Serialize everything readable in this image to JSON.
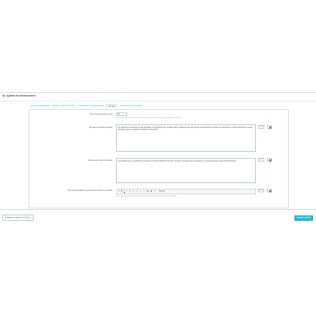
{
  "panel": {
    "title": "Ajustes de devoluciones",
    "icon": "wrench-icon"
  },
  "tabs": [
    {
      "label": "AJUSTES GENERALES",
      "active": false
    },
    {
      "label": "ESTADO Y NOTIFICACIÓN",
      "active": false
    },
    {
      "label": "PRINCIPIOS Y CONDICIONES",
      "active": false
    },
    {
      "label": "EXTRAS",
      "active": true
    },
    {
      "label": "NOTIFICARLOS DE NUEVO",
      "active": false
    }
  ],
  "fields": {
    "days": {
      "label": "Plazo de devolución en días",
      "value": "14",
      "help": "Número de días durante los cuales el cliente puede solicitar la devolución de un pedido. 0 = sin límite."
    },
    "msg_accepted": {
      "label": "Mensaje de estado aprobado",
      "value": "Su solicitud de devolución ha sido aprobada. La información que necesita sobre el siguiente paso del proceso de devolución se enviará a su dirección de correo electrónico en breve. Por favor, espere el siguiente mensaje de información.",
      "lang_button": "es ▾"
    },
    "msg_refused": {
      "label": "Mensaje de estado rechazado",
      "value": "Lamentablemente, su solicitud de devolución ha sido rechazada. Por favor, consulte el mensaje que le enviamos en el correo electrónico para más información.",
      "lang_button": "es ▾"
    },
    "confirm_text": {
      "label": "Texto de la pantalla de confirmación de Envío de Pedido",
      "help": "Utilice este espacio para añadir información adicional a la pantalla de confirmación del pedido.",
      "lang_button": "es ▾",
      "toolbar_font_label": "Párrafo"
    }
  },
  "footer": {
    "reset_label": "Restablecer valores por defecto",
    "save_label": "Guardar ajustes"
  }
}
